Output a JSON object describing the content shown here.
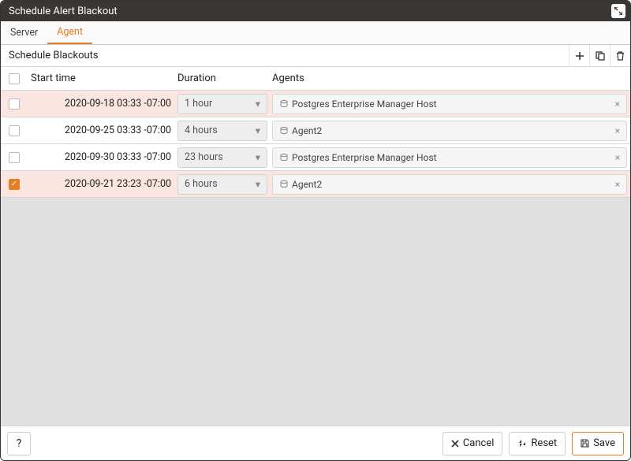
{
  "title": "Schedule Alert Blackout",
  "tabs": [
    {
      "label": "Server",
      "active": false
    },
    {
      "label": "Agent",
      "active": true
    }
  ],
  "grid_header": "Schedule Blackouts",
  "columns": {
    "start": "Start time",
    "duration": "Duration",
    "agents": "Agents"
  },
  "rows": [
    {
      "checked": false,
      "highlight": true,
      "start": "2020-09-18 03:33 -07:00",
      "duration": "1 hour",
      "agent": "Postgres Enterprise Manager Host"
    },
    {
      "checked": false,
      "highlight": false,
      "start": "2020-09-25 03:33 -07:00",
      "duration": "4 hours",
      "agent": "Agent2"
    },
    {
      "checked": false,
      "highlight": false,
      "start": "2020-09-30 03:33 -07:00",
      "duration": "23 hours",
      "agent": "Postgres Enterprise Manager Host"
    },
    {
      "checked": true,
      "highlight": true,
      "start": "2020-09-21 23:23 -07:00",
      "duration": "6 hours",
      "agent": "Agent2"
    }
  ],
  "footer": {
    "help": "?",
    "cancel": "Cancel",
    "reset": "Reset",
    "save": "Save"
  }
}
